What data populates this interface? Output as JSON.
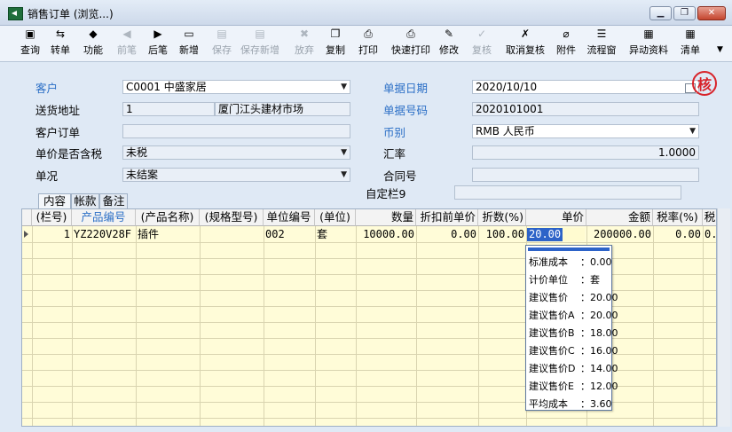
{
  "window": {
    "title": "销售订单 (浏览...)",
    "min": "▁",
    "max": "❐",
    "close": "✕"
  },
  "toolbar": [
    {
      "name": "query",
      "label": "查询",
      "icon": "▣",
      "enabled": true
    },
    {
      "name": "convert",
      "label": "转单",
      "icon": "⇆",
      "enabled": true
    },
    {
      "name": "function",
      "label": "功能",
      "icon": "◆",
      "enabled": true
    },
    {
      "name": "prev",
      "label": "前笔",
      "icon": "◀",
      "enabled": false
    },
    {
      "name": "next",
      "label": "后笔",
      "icon": "▶",
      "enabled": true
    },
    {
      "name": "new",
      "label": "新增",
      "icon": "▭",
      "enabled": true
    },
    {
      "name": "save",
      "label": "保存",
      "icon": "▤",
      "enabled": false
    },
    {
      "name": "save-new",
      "label": "保存新增",
      "icon": "▤",
      "enabled": false
    },
    {
      "name": "discard",
      "label": "放弃",
      "icon": "✖",
      "enabled": false
    },
    {
      "name": "copy",
      "label": "复制",
      "icon": "❐",
      "enabled": true
    },
    {
      "name": "print",
      "label": "打印",
      "icon": "⎙",
      "enabled": true
    },
    {
      "name": "quick-print",
      "label": "快速打印",
      "icon": "⎙",
      "enabled": true
    },
    {
      "name": "modify",
      "label": "修改",
      "icon": "✎",
      "enabled": true
    },
    {
      "name": "review",
      "label": "复核",
      "icon": "✓",
      "enabled": false
    },
    {
      "name": "cancel-review",
      "label": "取消复核",
      "icon": "✗",
      "enabled": true
    },
    {
      "name": "attachment",
      "label": "附件",
      "icon": "⌀",
      "enabled": true
    },
    {
      "name": "flow-window",
      "label": "流程窗",
      "icon": "☰",
      "enabled": true
    },
    {
      "name": "change-info",
      "label": "异动资料",
      "icon": "▦",
      "enabled": true
    },
    {
      "name": "clear",
      "label": "清单",
      "icon": "▦",
      "enabled": true
    }
  ],
  "form": {
    "customer_label": "客户",
    "customer_value": "C0001  中盛家居",
    "address_label": "送货地址",
    "address_code": "1",
    "address_value": "厦门江头建材市场",
    "customer_order_label": "客户订单",
    "customer_order_value": "",
    "tax_included_label": "单价是否含税",
    "tax_included_value": "未税",
    "status_label": "单况",
    "status_value": "未结案",
    "doc_date_label": "单据日期",
    "doc_date_value": "2020/10/10",
    "doc_no_label": "单据号码",
    "doc_no_value": "2020101001",
    "currency_label": "币别",
    "currency_value": "RMB  人民币",
    "rate_label": "汇率",
    "rate_value": "1.0000",
    "contract_label": "合同号",
    "contract_value": "",
    "custom9_label": "自定栏9",
    "custom9_value": "",
    "stamp": "核"
  },
  "tabs": [
    "内容",
    "帐款",
    "备注"
  ],
  "grid": {
    "headers": [
      "(栏号)",
      "产品编号",
      "(产品名称)",
      "(规格型号)",
      "单位编号",
      "(单位)",
      "数量",
      "折扣前单价",
      "折数(%)",
      "单价",
      "金额",
      "税率(%)",
      "税"
    ],
    "row": {
      "no": "1",
      "product_code": "YZ220V28F",
      "product_name": "插件",
      "spec": "",
      "unit_code": "002",
      "unit": "套",
      "qty": "10000.00",
      "pre_discount_price": "0.00",
      "discount": "100.00",
      "price": "20.00",
      "amount": "200000.00",
      "tax_rate": "0.00",
      "tax": "0."
    }
  },
  "popup": [
    {
      "label": "标准成本",
      "value": "：0.00"
    },
    {
      "label": "计价单位",
      "value": "：套"
    },
    {
      "label": "建议售价",
      "value": "：20.00"
    },
    {
      "label": "建议售价A",
      "value": "：20.00"
    },
    {
      "label": "建议售价B",
      "value": "：18.00"
    },
    {
      "label": "建议售价C",
      "value": "：16.00"
    },
    {
      "label": "建议售价D",
      "value": "：14.00"
    },
    {
      "label": "建议售价E",
      "value": "：12.00"
    },
    {
      "label": "平均成本",
      "value": "：3.60"
    }
  ]
}
